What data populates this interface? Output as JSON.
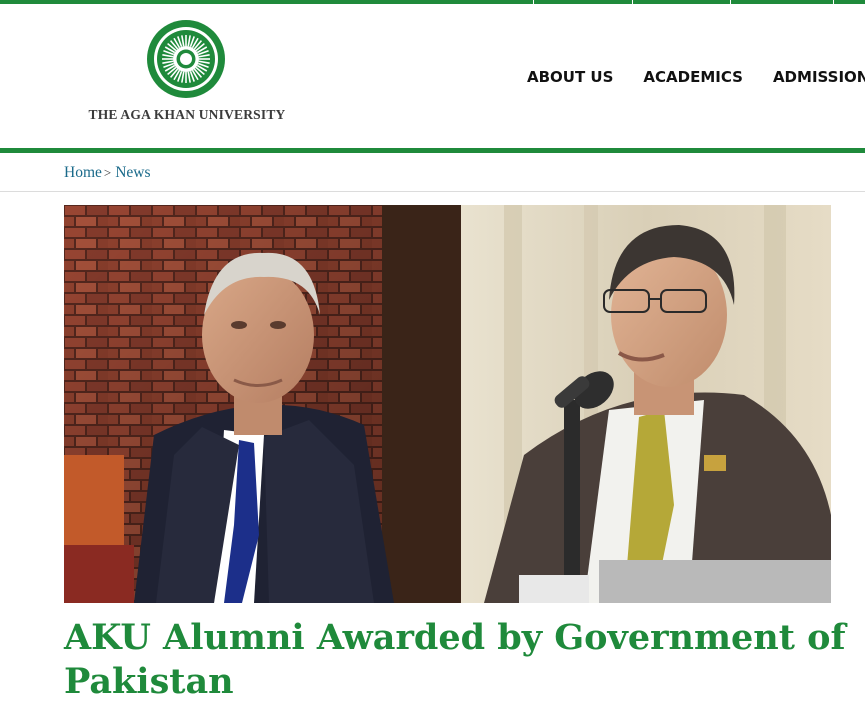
{
  "brand": {
    "name": "THE AGA KHAN UNIVERSITY",
    "logo_icon": "aku-sun-seal-icon",
    "accent_color": "#1f8a3b"
  },
  "nav": {
    "items": [
      {
        "label": "ABOUT US"
      },
      {
        "label": "ACADEMICS"
      },
      {
        "label": "ADMISSIONS"
      }
    ]
  },
  "breadcrumb": {
    "home": "Home",
    "separator": ">",
    "current": "News",
    "link_color": "#1a6a8a"
  },
  "hero": {
    "image_left": "portrait-man-dark-suit-brick-wall",
    "image_right": "man-speaking-at-microphone-podium"
  },
  "article": {
    "title": "AKU Alumni Awarded by Government of Pakistan"
  }
}
